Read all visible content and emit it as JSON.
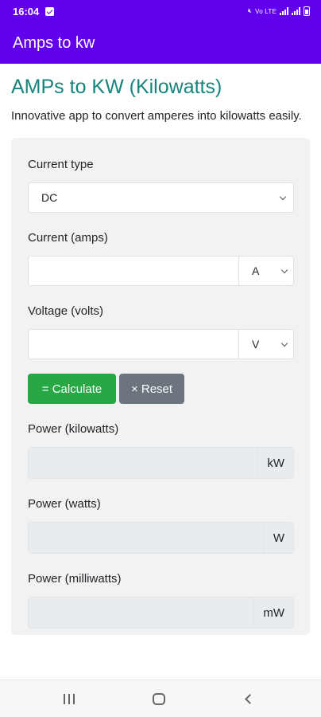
{
  "status_bar": {
    "time": "16:04",
    "indicators": "Vo LTE",
    "icons": [
      "message-icon",
      "mute-icon",
      "wifi-icon",
      "signal-icon",
      "battery-icon"
    ]
  },
  "app_bar": {
    "title": "Amps to kw"
  },
  "page": {
    "title": "AMPs to KW (Kilowatts)",
    "description": "Innovative app to convert amperes into kilowatts easily."
  },
  "form": {
    "current_type": {
      "label": "Current type",
      "value": "DC"
    },
    "current": {
      "label": "Current (amps)",
      "value": "",
      "unit": "A"
    },
    "voltage": {
      "label": "Voltage (volts)",
      "value": "",
      "unit": "V"
    },
    "calculate_label": "= Calculate",
    "reset_label": "× Reset"
  },
  "results": {
    "kilowatts": {
      "label": "Power (kilowatts)",
      "unit": "kW",
      "value": ""
    },
    "watts": {
      "label": "Power (watts)",
      "unit": "W",
      "value": ""
    },
    "milliwatts": {
      "label": "Power (milliwatts)",
      "unit": "mW",
      "value": ""
    }
  },
  "colors": {
    "app_bar": "#6200ee",
    "title": "#17857c",
    "calculate": "#28a745",
    "reset": "#6c757d"
  }
}
